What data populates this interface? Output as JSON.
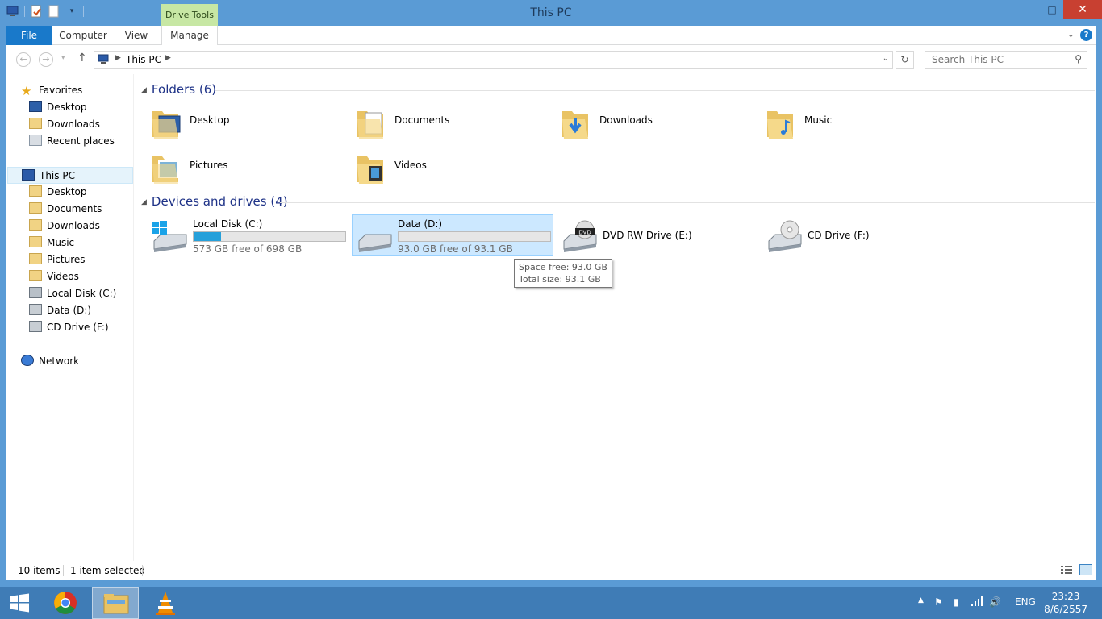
{
  "window": {
    "title": "This PC",
    "context_tab": "Drive Tools",
    "colors": {
      "titlebar": "#5a9bd5",
      "file_tab": "#1979ca",
      "context_tab": "#c7e7a4",
      "close": "#c84031",
      "group_heading": "#1e3287",
      "selection": "#cce8ff",
      "capacity_bar": "#26a0da"
    }
  },
  "ribbon": {
    "tabs": [
      "File",
      "Computer",
      "View",
      "Manage"
    ],
    "help": "?"
  },
  "address": {
    "crumb": "This PC",
    "search_placeholder": "Search This PC"
  },
  "nav": {
    "favorites": "Favorites",
    "favorites_items": [
      "Desktop",
      "Downloads",
      "Recent places"
    ],
    "this_pc": "This PC",
    "this_pc_items": [
      "Desktop",
      "Documents",
      "Downloads",
      "Music",
      "Pictures",
      "Videos",
      "Local Disk (C:)",
      "Data (D:)",
      "CD Drive (F:)"
    ],
    "network": "Network"
  },
  "folders": {
    "heading": "Folders (6)",
    "items": [
      "Desktop",
      "Documents",
      "Downloads",
      "Music",
      "Pictures",
      "Videos"
    ]
  },
  "drives": {
    "heading": "Devices and drives (4)",
    "items": [
      {
        "name": "Local Disk (C:)",
        "free": "573 GB free of 698 GB",
        "used_fraction": 0.179
      },
      {
        "name": "Data (D:)",
        "free": "93.0 GB free of 93.1 GB",
        "used_fraction": 0.001
      },
      {
        "name": "DVD RW Drive (E:)"
      },
      {
        "name": "CD Drive (F:)"
      }
    ]
  },
  "tooltip": {
    "line1": "Space free: 93.0 GB",
    "line2": "Total size: 93.1 GB"
  },
  "status": {
    "items": "10 items",
    "selected": "1 item selected"
  },
  "taskbar": {
    "language": "ENG",
    "time": "23:23",
    "date": "8/6/2557"
  }
}
